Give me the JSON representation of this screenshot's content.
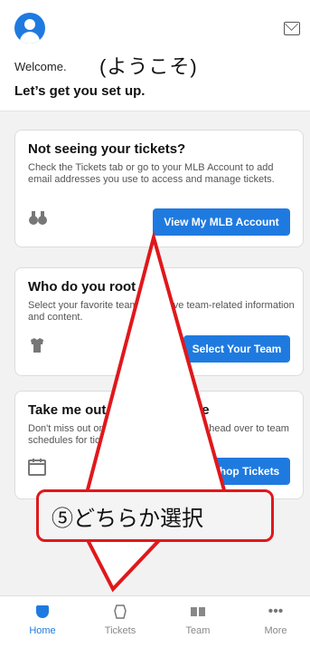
{
  "header": {
    "welcome": "Welcome.",
    "welcome_annotation": "(ようこそ)",
    "setup": "Let’s get you set up."
  },
  "cards": [
    {
      "title": "Not seeing your tickets?",
      "text": "Check the Tickets tab or go to your MLB Account to add email addresses you use to access and manage tickets.",
      "icon": "binoculars-icon",
      "button": "View My MLB Account"
    },
    {
      "title": "Who do you root for?",
      "text": "Select your favorite team to receive team-related information and content.",
      "icon": "jersey-icon",
      "button": "Select Your Team"
    },
    {
      "title": "Take me out to the ballgame",
      "text": "Don't miss out on the action this season, head over to team schedules for ticketed events",
      "icon": "calendar-icon",
      "button": "Shop Tickets"
    }
  ],
  "nav": [
    {
      "label": "Home",
      "icon": "home-icon",
      "active": true
    },
    {
      "label": "Tickets",
      "icon": "ticket-icon"
    },
    {
      "label": "Team",
      "icon": "team-icon"
    },
    {
      "label": "More",
      "icon": "more-icon"
    }
  ],
  "annotation": {
    "callout": "⑤どちらか選択"
  },
  "colors": {
    "accent": "#1f7ae0",
    "callout_red": "#e0181b"
  }
}
